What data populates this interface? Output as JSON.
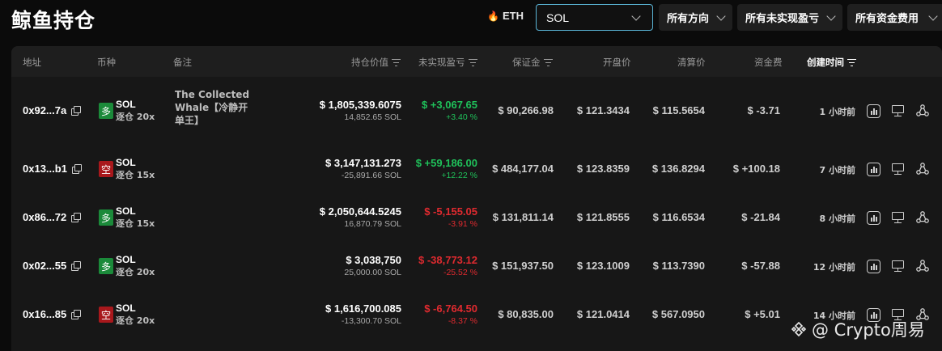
{
  "header": {
    "title": "鲸鱼持仓",
    "eth_label": "ETH",
    "symbol_select": "SOL",
    "direction_filter": "所有方向",
    "pnl_filter": "所有未实现盈亏",
    "funding_filter": "所有资金费用"
  },
  "table": {
    "columns": {
      "address": "地址",
      "coin": "币种",
      "note": "备注",
      "position_value": "持仓价值",
      "unrealized_pnl": "未实现盈亏",
      "margin": "保证金",
      "entry_price": "开盘价",
      "liq_price": "清算价",
      "funding": "资金费",
      "created": "创建时间"
    },
    "rows": [
      {
        "address": "0x92...7a",
        "side_label": "多",
        "side": "long",
        "coin": "SOL",
        "leverage": "逐仓 20x",
        "note": "The Collected Whale【冷静开单王】",
        "value": "$ 1,805,339.6075",
        "size": "14,852.65 SOL",
        "pnl": "$ +3,067.65",
        "pnl_pct": "+3.40 %",
        "pnl_sign": "pos",
        "margin": "$ 90,266.98",
        "entry": "$ 121.3434",
        "liq": "$ 115.5654",
        "funding": "$ -3.71",
        "funding_sign": "neg",
        "time": "1 小时前"
      },
      {
        "address": "0x13...b1",
        "side_label": "空",
        "side": "short",
        "coin": "SOL",
        "leverage": "逐仓 15x",
        "note": "",
        "value": "$ 3,147,131.273",
        "size": "-25,891.66 SOL",
        "pnl": "$ +59,186.00",
        "pnl_pct": "+12.22 %",
        "pnl_sign": "pos",
        "margin": "$ 484,177.04",
        "entry": "$ 123.8359",
        "liq": "$ 136.8294",
        "funding": "$ +100.18",
        "funding_sign": "pos",
        "time": "7 小时前"
      },
      {
        "address": "0x86...72",
        "side_label": "多",
        "side": "long",
        "coin": "SOL",
        "leverage": "逐仓 15x",
        "note": "",
        "value": "$ 2,050,644.5245",
        "size": "16,870.79 SOL",
        "pnl": "$ -5,155.05",
        "pnl_pct": "-3.91 %",
        "pnl_sign": "neg",
        "margin": "$ 131,811.14",
        "entry": "$ 121.8555",
        "liq": "$ 116.6534",
        "funding": "$ -21.84",
        "funding_sign": "neg",
        "time": "8 小时前"
      },
      {
        "address": "0x02...55",
        "side_label": "多",
        "side": "long",
        "coin": "SOL",
        "leverage": "逐仓 20x",
        "note": "",
        "value": "$ 3,038,750",
        "size": "25,000.00 SOL",
        "pnl": "$ -38,773.12",
        "pnl_pct": "-25.52 %",
        "pnl_sign": "neg",
        "margin": "$ 151,937.50",
        "entry": "$ 123.1009",
        "liq": "$ 113.7390",
        "funding": "$ -57.88",
        "funding_sign": "neg",
        "time": "12 小时前"
      },
      {
        "address": "0x16...85",
        "side_label": "空",
        "side": "short",
        "coin": "SOL",
        "leverage": "逐仓 20x",
        "note": "",
        "value": "$ 1,616,700.085",
        "size": "-13,300.70 SOL",
        "pnl": "$ -6,764.50",
        "pnl_pct": "-8.37 %",
        "pnl_sign": "neg",
        "margin": "$ 80,835.00",
        "entry": "$ 121.0414",
        "liq": "$ 567.0950",
        "funding": "$ +5.01",
        "funding_sign": "pos",
        "time": "14 小时前"
      }
    ]
  },
  "watermark": "@ Crypto周易",
  "colors": {
    "positive": "#1fc15a",
    "negative": "#e02a2f",
    "long": "#1b8a3a",
    "short": "#a8181c",
    "accent_border": "#5ab4d6"
  }
}
